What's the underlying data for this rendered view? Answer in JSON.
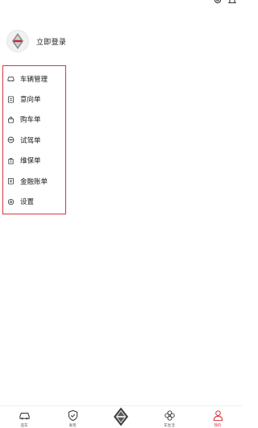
{
  "header": {
    "icons": [
      "settings-icon",
      "bell-icon"
    ]
  },
  "profile": {
    "avatar_icon": "brand-logo-icon",
    "login_label": "立即登录"
  },
  "menu": {
    "items": [
      {
        "label": "车辆管理",
        "icon": "car-icon"
      },
      {
        "label": "意向单",
        "icon": "note-icon"
      },
      {
        "label": "购车单",
        "icon": "bag-icon"
      },
      {
        "label": "试驾单",
        "icon": "steering-wheel-icon"
      },
      {
        "label": "维保单",
        "icon": "maintenance-icon"
      },
      {
        "label": "金融账单",
        "icon": "finance-icon"
      },
      {
        "label": "设置",
        "icon": "settings-icon"
      }
    ]
  },
  "tabbar": {
    "tabs": [
      {
        "label": "选车",
        "icon": "car-icon"
      },
      {
        "label": "发现",
        "icon": "shield-icon"
      },
      {
        "label": "",
        "icon": "brand-logo-icon"
      },
      {
        "label": "车生活",
        "icon": "flower-icon"
      },
      {
        "label": "我的",
        "icon": "user-icon",
        "active": true
      }
    ]
  },
  "colors": {
    "accent": "#d9363e",
    "text": "#1a1a1a",
    "background": "#ffffff"
  }
}
